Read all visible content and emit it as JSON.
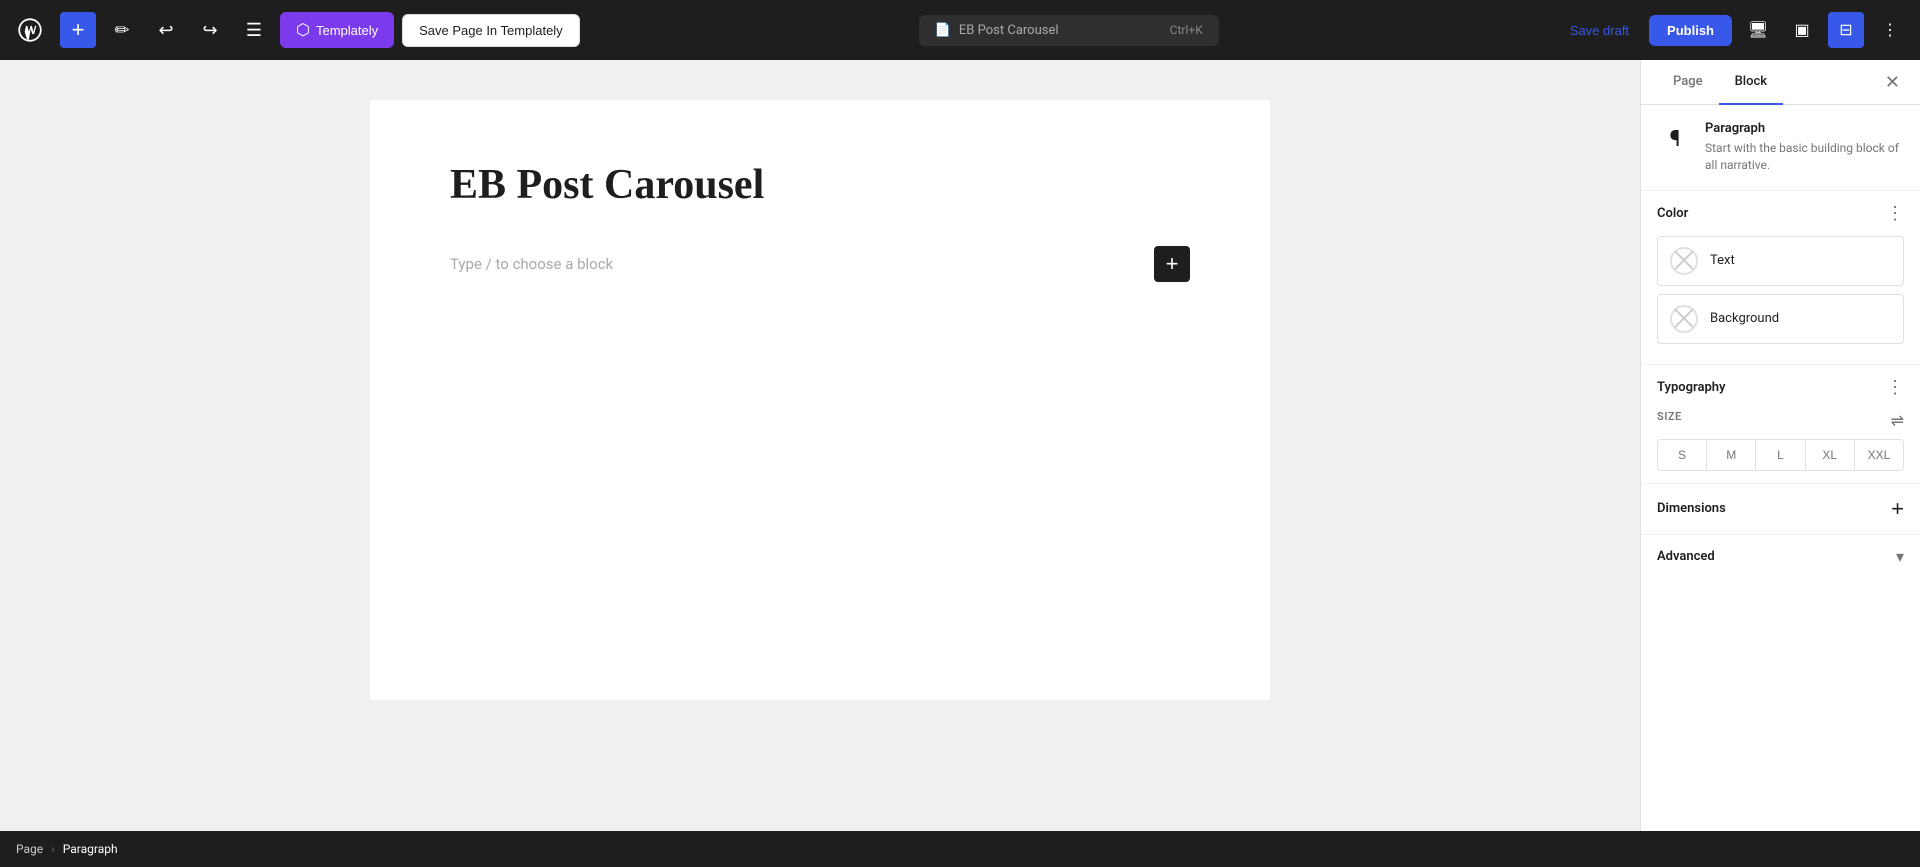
{
  "toolbar": {
    "add_label": "+",
    "templately_label": "Templately",
    "save_templately_label": "Save Page In Templately",
    "post_title": "EB Post Carousel",
    "shortcut": "Ctrl+K",
    "save_draft_label": "Save draft",
    "publish_label": "Publish"
  },
  "editor": {
    "post_title": "EB Post Carousel",
    "block_placeholder": "Type / to choose a block"
  },
  "breadcrumb": {
    "page": "Page",
    "separator": "›",
    "current": "Paragraph"
  },
  "panel": {
    "page_tab": "Page",
    "block_tab": "Block",
    "block_info": {
      "name": "Paragraph",
      "description": "Start with the basic building block of all narrative."
    },
    "color_section": {
      "title": "Color",
      "text_label": "Text",
      "background_label": "Background"
    },
    "typography_section": {
      "title": "Typography",
      "size_label": "SIZE",
      "sizes": [
        "S",
        "M",
        "L",
        "XL",
        "XXL"
      ]
    },
    "dimensions_section": {
      "title": "Dimensions"
    },
    "advanced_section": {
      "title": "Advanced"
    }
  }
}
